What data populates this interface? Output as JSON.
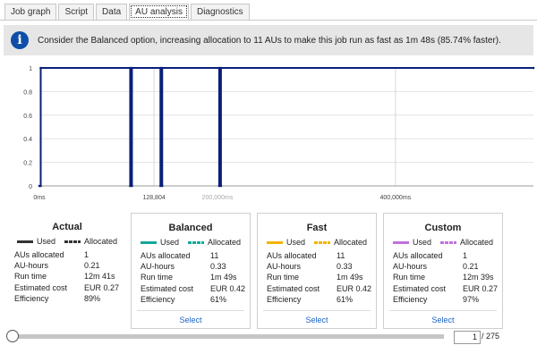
{
  "tabs": [
    {
      "label": "Job graph"
    },
    {
      "label": "Script"
    },
    {
      "label": "Data"
    },
    {
      "label": "AU analysis",
      "active": true
    },
    {
      "label": "Diagnostics"
    }
  ],
  "banner": {
    "icon": "info-icon",
    "text": "Consider the Balanced option, increasing allocation to 11 AUs to make this job run as fast as 1m 48s (85.74% faster)."
  },
  "chart_data": {
    "type": "line",
    "y_ticks": [
      "1",
      "0.8",
      "0.6",
      "0.4",
      "0.2",
      "0"
    ],
    "x_ticks": [
      "0ms",
      "128,804",
      "200,000ms",
      "400,000ms"
    ],
    "ylim": [
      0,
      1
    ],
    "xlim": [
      0,
      555000
    ],
    "series": [
      {
        "color": "#0a1f7a",
        "x": [
          0,
          1500,
          1500,
          102000,
          102000,
          104000,
          104000,
          136000,
          136000,
          138000,
          138000,
          202000,
          202000,
          204000,
          204000,
          555000
        ],
        "y": [
          0,
          0,
          1,
          1,
          0,
          0,
          1,
          1,
          0,
          0,
          1,
          1,
          0,
          0,
          1,
          1
        ]
      }
    ],
    "grid": true
  },
  "actual": {
    "title": "Actual",
    "used_label": "Used",
    "allocated_label": "Allocated",
    "used_color": "#333333",
    "allocated_color": "#333333",
    "rows": [
      {
        "label": "AUs allocated",
        "value": "1"
      },
      {
        "label": "AU-hours",
        "value": "0.21"
      },
      {
        "label": "Run time",
        "value": "12m 41s"
      },
      {
        "label": "Estimated cost",
        "value": "EUR 0.27"
      },
      {
        "label": "Efficiency",
        "value": "89%"
      }
    ]
  },
  "options": [
    {
      "title": "Balanced",
      "used_label": "Used",
      "allocated_label": "Allocated",
      "color": "#14a89a",
      "rows": [
        {
          "label": "AUs allocated",
          "value": "11"
        },
        {
          "label": "AU-hours",
          "value": "0.33"
        },
        {
          "label": "Run time",
          "value": "1m 49s"
        },
        {
          "label": "Estimated cost",
          "value": "EUR 0.42"
        },
        {
          "label": "Efficiency",
          "value": "61%"
        }
      ],
      "select_label": "Select"
    },
    {
      "title": "Fast",
      "used_label": "Used",
      "allocated_label": "Allocated",
      "color": "#f4b400",
      "rows": [
        {
          "label": "AUs allocated",
          "value": "11"
        },
        {
          "label": "AU-hours",
          "value": "0.33"
        },
        {
          "label": "Run time",
          "value": "1m 49s"
        },
        {
          "label": "Estimated cost",
          "value": "EUR 0.42"
        },
        {
          "label": "Efficiency",
          "value": "61%"
        }
      ],
      "select_label": "Select"
    },
    {
      "title": "Custom",
      "used_label": "Used",
      "allocated_label": "Allocated",
      "color": "#c070e0",
      "rows": [
        {
          "label": "AUs allocated",
          "value": "1"
        },
        {
          "label": "AU-hours",
          "value": "0.21"
        },
        {
          "label": "Run time",
          "value": "12m 39s"
        },
        {
          "label": "Estimated cost",
          "value": "EUR 0.27"
        },
        {
          "label": "Efficiency",
          "value": "97%"
        }
      ],
      "select_label": "Select"
    }
  ],
  "slider": {
    "value": 0
  },
  "pager": {
    "current": "1",
    "total": "/ 275"
  }
}
